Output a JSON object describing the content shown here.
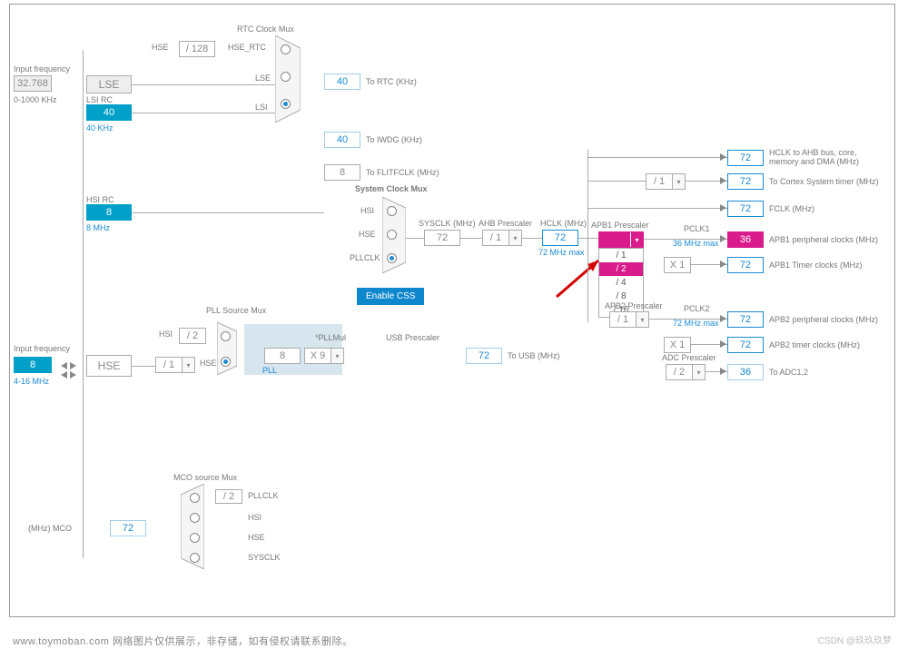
{
  "inputs": {
    "lse_freq_label": "Input frequency",
    "lse_value": "32.768",
    "lse_range": "0-1000 KHz",
    "hse_freq_label": "Input frequency",
    "hse_value": "8",
    "hse_range": "4-16 MHz"
  },
  "sources": {
    "lse": {
      "name": "LSE"
    },
    "lsi": {
      "label": "LSI RC",
      "value": "40",
      "unit": "40 KHz"
    },
    "hsi": {
      "label": "HSI RC",
      "value": "8",
      "unit": "8 MHz"
    },
    "hse": {
      "name": "HSE"
    }
  },
  "rtc": {
    "title": "RTC Clock Mux",
    "hse_div": "/ 128",
    "hse_rtc": "HSE_RTC",
    "hse_label": "HSE",
    "lse_label": "LSE",
    "lsi_label": "LSI",
    "out_value": "40",
    "out_label": "To RTC (KHz)"
  },
  "iwdg": {
    "value": "40",
    "label": "To IWDG (KHz)"
  },
  "flitf": {
    "value": "8",
    "label": "To FLITFCLK (MHz)"
  },
  "pll": {
    "src_title": "PLL Source Mux",
    "div2": "/ 2",
    "presc": "/ 1",
    "hsi_label": "HSI",
    "hse_label": "HSE",
    "value": "8",
    "name": "PLL",
    "mul_label": "*PLLMul",
    "mul": "X 9"
  },
  "sysclk": {
    "title": "System Clock Mux",
    "hsi": "HSI",
    "hse": "HSE",
    "pllclk": "PLLCLK",
    "css": "Enable CSS",
    "label": "SYSCLK (MHz)",
    "value": "72"
  },
  "usb": {
    "title": "USB Prescaler",
    "value": "72",
    "label": "To USB (MHz)"
  },
  "ahb": {
    "title": "AHB Prescaler",
    "presc": "/ 1",
    "hclk_label": "HCLK (MHz)",
    "value": "72",
    "hclk_note": "72 MHz max"
  },
  "outputs": {
    "hclk_ahb": {
      "value": "72",
      "label": "HCLK to AHB bus, core, memory and DMA (MHz)"
    },
    "cortex": {
      "presc": "/ 1",
      "value": "72",
      "label": "To Cortex System timer (MHz)"
    },
    "fclk": {
      "value": "72",
      "label": "FCLK (MHz)"
    }
  },
  "apb1": {
    "title": "APB1 Prescaler",
    "presc_sel": "/ 2",
    "options": [
      "/ 1",
      "/ 2",
      "/ 4",
      "/ 8",
      "/ 16"
    ],
    "pclk1_label": "PCLK1",
    "pclk1_note": "36 MHz max",
    "periph": {
      "value": "36",
      "label": "APB1 peripheral clocks (MHz)"
    },
    "timer_mul": "X 1",
    "timer": {
      "value": "72",
      "label": "APB1 Timer clocks (MHz)"
    }
  },
  "apb2": {
    "title": "APB2 Prescaler",
    "presc": "/ 1",
    "pclk2_label": "PCLK2",
    "pclk2_note": "72 MHz max",
    "periph": {
      "value": "72",
      "label": "APB2 peripheral clocks (MHz)"
    },
    "timer_mul": "X 1",
    "timer": {
      "value": "72",
      "label": "APB2 timer clocks (MHz)"
    }
  },
  "adc": {
    "title": "ADC Prescaler",
    "presc": "/ 2",
    "value": "36",
    "label": "To ADC1,2"
  },
  "mco": {
    "title": "MCO source Mux",
    "value": "72",
    "label": "(MHz) MCO",
    "div": "/ 2",
    "opts": [
      "PLLCLK",
      "HSI",
      "HSE",
      "SYSCLK"
    ]
  },
  "footer": "www.toymoban.com  网络图片仅供展示，非存储，如有侵权请联系删除。",
  "watermark": "CSDN @玖玖玖梦"
}
